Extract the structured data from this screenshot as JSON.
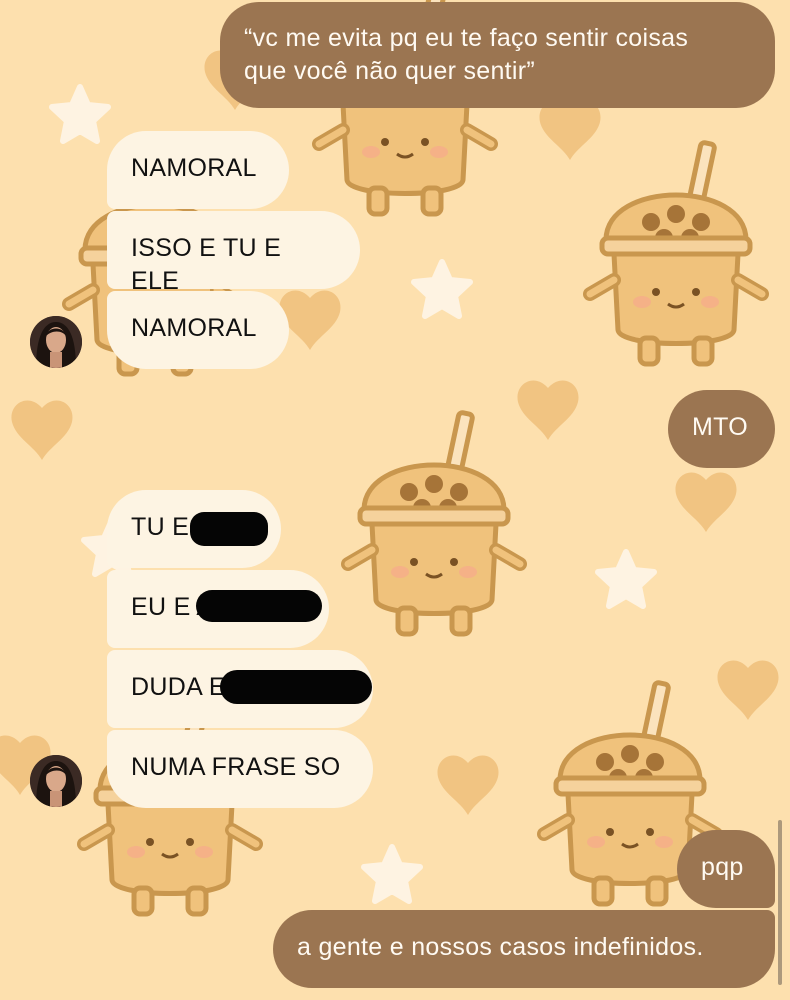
{
  "messages": [
    {
      "id": "m1",
      "side": "out",
      "text": "“vc me evita pq eu te faço sentir coisas\nque você não quer sentir”"
    },
    {
      "id": "m2",
      "side": "in",
      "text": "NAMORAL"
    },
    {
      "id": "m3",
      "side": "in",
      "text": "ISSO E TU E ELE"
    },
    {
      "id": "m4",
      "side": "in",
      "text": "NAMORAL"
    },
    {
      "id": "m5",
      "side": "out",
      "text": "MTO"
    },
    {
      "id": "m6",
      "side": "in",
      "text": "TU E"
    },
    {
      "id": "m7",
      "side": "in",
      "text": "EU E A"
    },
    {
      "id": "m8",
      "side": "in",
      "text": "DUDA E"
    },
    {
      "id": "m9",
      "side": "in",
      "text": "NUMA FRASE SO"
    },
    {
      "id": "m10",
      "side": "out",
      "text": "pqp"
    },
    {
      "id": "m11",
      "side": "out",
      "text": "a gente e nossos casos indefinidos."
    }
  ],
  "colors": {
    "background": "#fde0ae",
    "incoming_bubble": "#fdf4e3",
    "outgoing_bubble": "#9b7551",
    "pattern": "#f0c481"
  },
  "icons": [
    "contact-avatar-icon",
    "boba-tea-decoration",
    "heart-decoration",
    "star-decoration"
  ]
}
